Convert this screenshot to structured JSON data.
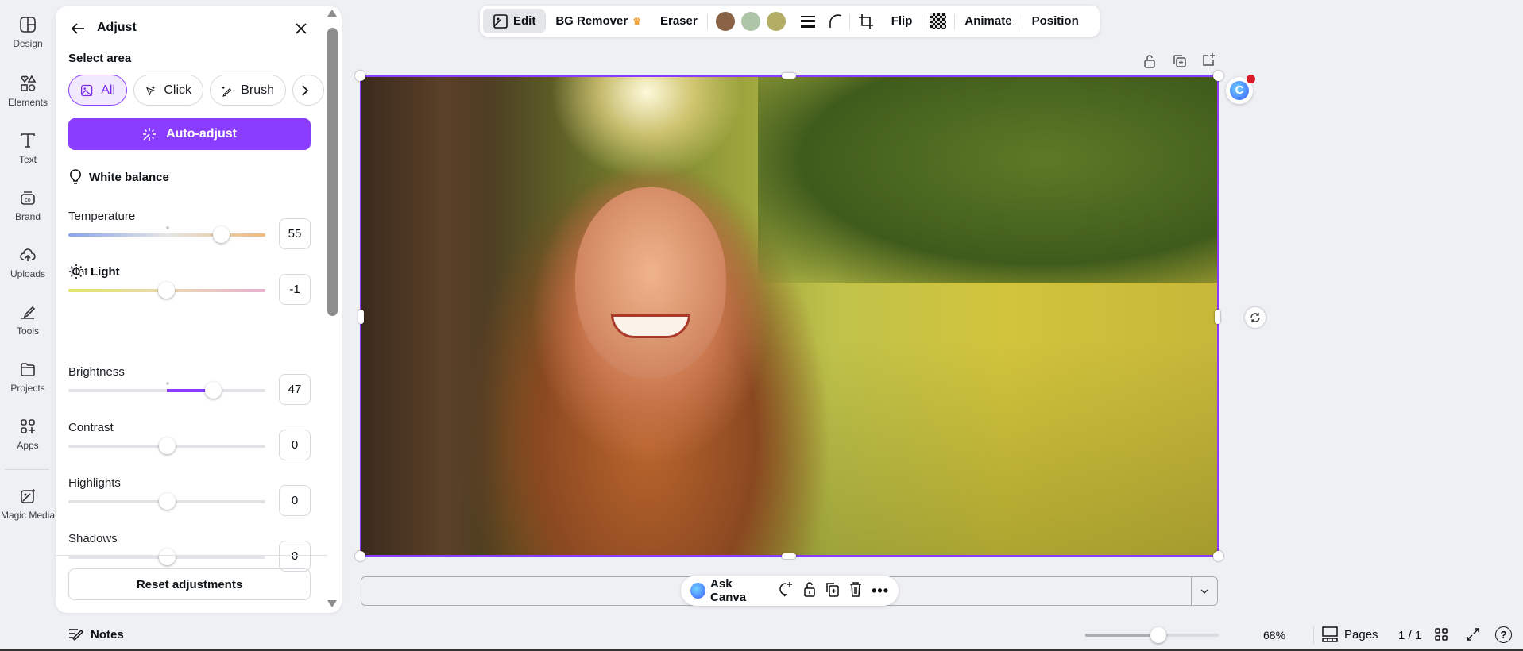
{
  "sidebar": {
    "items": [
      {
        "label": "Design",
        "icon": "layout-icon"
      },
      {
        "label": "Elements",
        "icon": "shapes-icon"
      },
      {
        "label": "Text",
        "icon": "text-icon"
      },
      {
        "label": "Brand",
        "icon": "brand-icon"
      },
      {
        "label": "Uploads",
        "icon": "cloud-upload-icon"
      },
      {
        "label": "Tools",
        "icon": "pen-icon"
      },
      {
        "label": "Projects",
        "icon": "folder-icon"
      },
      {
        "label": "Apps",
        "icon": "apps-icon"
      },
      {
        "label": "Magic Media",
        "icon": "magic-media-icon"
      }
    ]
  },
  "panel": {
    "title": "Adjust",
    "select_area": "Select area",
    "chips": [
      "All",
      "Click",
      "Brush"
    ],
    "auto_adjust": "Auto-adjust",
    "white_balance": "White balance",
    "light": "Light",
    "sliders": [
      {
        "label": "Temperature",
        "value": "55",
        "fraction": 0.775
      },
      {
        "label": "Tint",
        "value": "-1",
        "fraction": 0.495
      },
      {
        "label": "Brightness",
        "value": "47",
        "fraction": 0.735
      },
      {
        "label": "Contrast",
        "value": "0",
        "fraction": 0.5
      },
      {
        "label": "Highlights",
        "value": "0",
        "fraction": 0.5
      },
      {
        "label": "Shadows",
        "value": "0",
        "fraction": 0.5
      }
    ],
    "reset": "Reset adjustments"
  },
  "toolbar": {
    "edit": "Edit",
    "bg_remover": "BG Remover",
    "eraser": "Eraser",
    "colors": [
      "#8a6246",
      "#aec6a7",
      "#b3ad66"
    ],
    "flip": "Flip",
    "animate": "Animate",
    "position": "Position"
  },
  "accent": "#8b3dff",
  "ask_canva": "Ask Canva",
  "footer": {
    "notes": "Notes",
    "zoom": "68%",
    "zoom_fraction": 0.55,
    "pages": "Pages",
    "page_count": "1 / 1"
  }
}
